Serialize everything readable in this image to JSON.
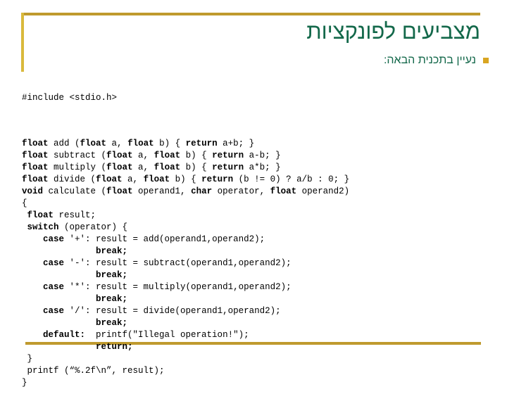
{
  "slide": {
    "title": "מצביעים לפונקציות",
    "bullet": {
      "marker": "square-bullet-icon",
      "text": "נעיין בתכנית הבאה:"
    },
    "colors": {
      "title_green": "#13684a",
      "rule_gold": "#bf9a2e",
      "rule_gold_light": "#d9b93c",
      "bullet_gold": "#d9a521",
      "code_black": "#000000",
      "background": "#ffffff"
    }
  },
  "code": {
    "include_line": "#include <stdio.h>",
    "lines": [
      [
        {
          "t": "float",
          "b": true
        },
        {
          "t": " add (",
          "b": false
        },
        {
          "t": "float",
          "b": true
        },
        {
          "t": " a, ",
          "b": false
        },
        {
          "t": "float",
          "b": true
        },
        {
          "t": " b) { ",
          "b": false
        },
        {
          "t": "return",
          "b": true
        },
        {
          "t": " a+b; }",
          "b": false
        }
      ],
      [
        {
          "t": "float",
          "b": true
        },
        {
          "t": " subtract (",
          "b": false
        },
        {
          "t": "float",
          "b": true
        },
        {
          "t": " a, ",
          "b": false
        },
        {
          "t": "float",
          "b": true
        },
        {
          "t": " b) { ",
          "b": false
        },
        {
          "t": "return",
          "b": true
        },
        {
          "t": " a-b; }",
          "b": false
        }
      ],
      [
        {
          "t": "float",
          "b": true
        },
        {
          "t": " multiply (",
          "b": false
        },
        {
          "t": "float",
          "b": true
        },
        {
          "t": " a, ",
          "b": false
        },
        {
          "t": "float",
          "b": true
        },
        {
          "t": " b) { ",
          "b": false
        },
        {
          "t": "return",
          "b": true
        },
        {
          "t": " a*b; }",
          "b": false
        }
      ],
      [
        {
          "t": "float",
          "b": true
        },
        {
          "t": " divide (",
          "b": false
        },
        {
          "t": "float",
          "b": true
        },
        {
          "t": " a, ",
          "b": false
        },
        {
          "t": "float",
          "b": true
        },
        {
          "t": " b) { ",
          "b": false
        },
        {
          "t": "return",
          "b": true
        },
        {
          "t": " (b != 0) ? a/b : 0; }",
          "b": false
        }
      ],
      [
        {
          "t": "void",
          "b": true
        },
        {
          "t": " calculate (",
          "b": false
        },
        {
          "t": "float",
          "b": true
        },
        {
          "t": " operand1, ",
          "b": false
        },
        {
          "t": "char",
          "b": true
        },
        {
          "t": " operator, ",
          "b": false
        },
        {
          "t": "float",
          "b": true
        },
        {
          "t": " operand2)",
          "b": false
        }
      ],
      [
        {
          "t": "{",
          "b": false
        }
      ],
      [
        {
          "t": " ",
          "b": false
        },
        {
          "t": "float",
          "b": true
        },
        {
          "t": " result;",
          "b": false
        }
      ],
      [
        {
          "t": " ",
          "b": false
        },
        {
          "t": "switch",
          "b": true
        },
        {
          "t": " (operator) {",
          "b": false
        }
      ],
      [
        {
          "t": "    ",
          "b": false
        },
        {
          "t": "case",
          "b": true
        },
        {
          "t": " '+': result = add(operand1,operand2);",
          "b": false
        }
      ],
      [
        {
          "t": "              ",
          "b": false
        },
        {
          "t": "break;",
          "b": true
        }
      ],
      [
        {
          "t": "    ",
          "b": false
        },
        {
          "t": "case",
          "b": true
        },
        {
          "t": " '-': result = subtract(operand1,operand2);",
          "b": false
        }
      ],
      [
        {
          "t": "              ",
          "b": false
        },
        {
          "t": "break;",
          "b": true
        }
      ],
      [
        {
          "t": "    ",
          "b": false
        },
        {
          "t": "case",
          "b": true
        },
        {
          "t": " '*': result = multiply(operand1,operand2);",
          "b": false
        }
      ],
      [
        {
          "t": "              ",
          "b": false
        },
        {
          "t": "break;",
          "b": true
        }
      ],
      [
        {
          "t": "    ",
          "b": false
        },
        {
          "t": "case",
          "b": true
        },
        {
          "t": " '/': result = divide(operand1,operand2);",
          "b": false
        }
      ],
      [
        {
          "t": "              ",
          "b": false
        },
        {
          "t": "break;",
          "b": true
        }
      ],
      [
        {
          "t": "    ",
          "b": false
        },
        {
          "t": "default:",
          "b": true
        },
        {
          "t": "  printf(\"Illegal operation!\");",
          "b": false
        }
      ],
      [
        {
          "t": "              ",
          "b": false
        },
        {
          "t": "return;",
          "b": true
        }
      ],
      [
        {
          "t": " }",
          "b": false
        }
      ],
      [
        {
          "t": " printf (“%.2f\\n”, result);",
          "b": false
        }
      ],
      [
        {
          "t": "}",
          "b": false
        }
      ]
    ]
  }
}
